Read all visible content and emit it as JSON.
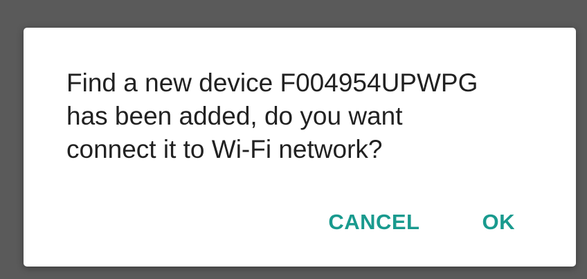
{
  "dialog": {
    "message": "Find a new device F004954UPWPG\nhas been added, do you want\nconnect it to Wi-Fi network?",
    "cancel_label": "CANCEL",
    "ok_label": "OK"
  },
  "colors": {
    "scrim": "#5a5a5a",
    "dialog_background": "#ffffff",
    "text": "#212121",
    "accent": "#199a8e"
  }
}
